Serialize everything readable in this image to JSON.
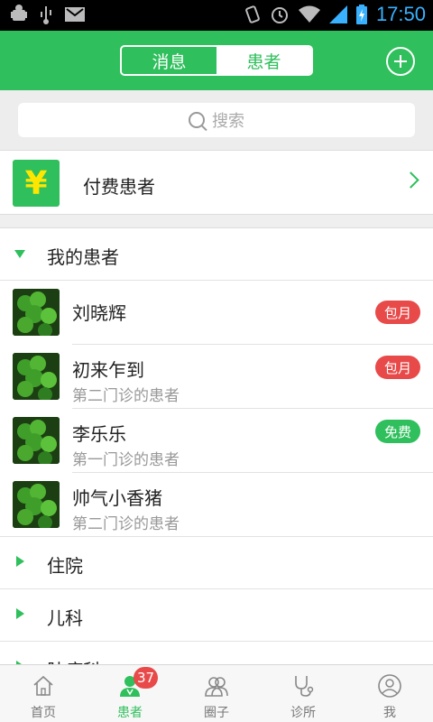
{
  "status_bar": {
    "time": "17:50"
  },
  "header": {
    "tabs": [
      {
        "label": "消息",
        "active": false
      },
      {
        "label": "患者",
        "active": true
      }
    ]
  },
  "search": {
    "placeholder": "搜索"
  },
  "paid_patients": {
    "label": "付费患者",
    "icon": "yen-icon"
  },
  "groups": [
    {
      "label": "我的患者",
      "expanded": true
    },
    {
      "label": "住院",
      "expanded": false
    },
    {
      "label": "儿科",
      "expanded": false
    },
    {
      "label": "肿瘤科",
      "expanded": false
    }
  ],
  "patients": [
    {
      "name": "刘晓辉",
      "note": "",
      "tag": "包月",
      "tag_color": "#e84a4a"
    },
    {
      "name": "初来乍到",
      "note": "第二门诊的患者",
      "tag": "包月",
      "tag_color": "#e84a4a"
    },
    {
      "name": "李乐乐",
      "note": "第一门诊的患者",
      "tag": "免费",
      "tag_color": "#2fbf5c"
    },
    {
      "name": "帅气小香猪",
      "note": "第二门诊的患者",
      "tag": "",
      "tag_color": ""
    }
  ],
  "bottom_nav": [
    {
      "label": "首页",
      "icon": "home-icon",
      "active": false
    },
    {
      "label": "患者",
      "icon": "doctor-icon",
      "active": true,
      "badge": "37"
    },
    {
      "label": "圈子",
      "icon": "people-icon",
      "active": false
    },
    {
      "label": "诊所",
      "icon": "stethoscope-icon",
      "active": false
    },
    {
      "label": "我",
      "icon": "user-icon",
      "active": false
    }
  ],
  "colors": {
    "accent": "#2fbf5c",
    "tag_red": "#e84a4a"
  }
}
